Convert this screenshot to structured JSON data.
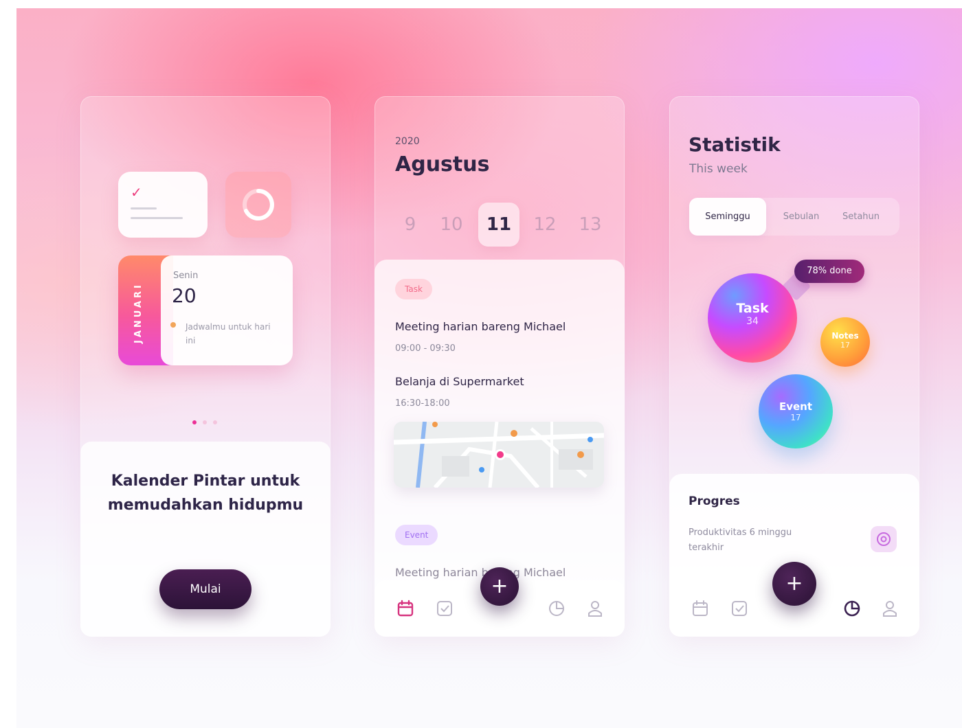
{
  "onboarding": {
    "month_label": "JANUARI",
    "day_name": "Senin",
    "day_number": "20",
    "note": "Jadwalmu untuk hari ini",
    "tagline": "Kalender Pintar untuk memudahkan hidupmu",
    "cta": "Mulai",
    "pager": {
      "count": 3,
      "active": 0
    }
  },
  "calendar": {
    "year": "2020",
    "month": "Agustus",
    "days": [
      "9",
      "10",
      "11",
      "12",
      "13"
    ],
    "selected_day": "11",
    "agenda": {
      "task_tag": "Task",
      "items": [
        {
          "title": "Meeting harian bareng Michael",
          "time": "09:00 - 09:30"
        },
        {
          "title": "Belanja di Supermarket",
          "time": "16:30-18:00"
        }
      ],
      "event_tag": "Event",
      "event_item": {
        "title": "Meeting harian bareng Michael"
      }
    },
    "nav_icons": [
      "calendar-icon",
      "checkbox-icon",
      "add-icon",
      "pie-chart-icon",
      "user-icon"
    ],
    "active_nav": "calendar-icon"
  },
  "stats": {
    "title": "Statistik",
    "subtitle": "This week",
    "periods": [
      "Seminggu",
      "Sebulan",
      "Setahun"
    ],
    "selected_period": "Seminggu",
    "done_label": "78% done",
    "bubbles": [
      {
        "label": "Task",
        "value": "34"
      },
      {
        "label": "Notes",
        "value": "17"
      },
      {
        "label": "Event",
        "value": "17"
      }
    ],
    "progress_title": "Progres",
    "progress_desc": "Produktivitas 6 minggu terakhir",
    "nav_icons": [
      "calendar-icon",
      "checkbox-icon",
      "add-icon",
      "pie-chart-icon",
      "user-icon"
    ],
    "active_nav": "pie-chart-icon"
  },
  "colors": {
    "accent_pink": "#ec2f96",
    "dark_purple": "#2c1338",
    "text_dark": "#2f2546"
  }
}
